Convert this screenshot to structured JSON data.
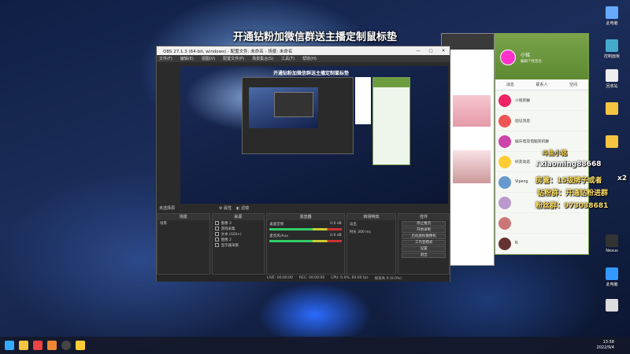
{
  "promo_banner": "开通钻粉加微信群送主播定制鼠标垫",
  "obs": {
    "title": "OBS 27.1.3 (64-bit, windows) - 配置文件: 未命名 - 场景: 未命名",
    "menu": [
      "文件(F)",
      "编辑(E)",
      "视图(V)",
      "配置文件(P)",
      "场景集合(S)",
      "工具(T)",
      "帮助(H)"
    ],
    "preview_title": "开通钻粉加微信群送主播定制鼠标垫",
    "status_left": "未选择源",
    "status_props": "属性",
    "status_filters": "滤镜",
    "docks": {
      "scenes": {
        "header": "场景",
        "item": "场景"
      },
      "sources": {
        "header": "来源",
        "items": [
          "图像 3",
          "游戏采集",
          "文本 (GDI+)",
          "图像 2",
          "显示器采集"
        ]
      },
      "mixer": {
        "header": "混音器",
        "ch1": "桌面音频",
        "ch2": "麦克风/Aux",
        "db": "0.0 dB"
      },
      "transition": {
        "header": "转场特效",
        "label1": "淡出",
        "label2": "时长",
        "duration": "300 ms"
      },
      "controls": {
        "header": "控件",
        "buttons": [
          "停止推流",
          "开始录制",
          "启动虚拟摄像机",
          "工作室模式",
          "设置",
          "退出"
        ]
      }
    },
    "bottom_stats": [
      "LIVE: 00:00:00",
      "REC: 00:00:00",
      "CPU: 0.0%, 60.00 fps",
      "帧丢失 0 (0.0%)"
    ]
  },
  "qq": {
    "name": "小铭",
    "signature": "编辑个性签名",
    "tabs": [
      "消息",
      "联系人",
      "空间"
    ],
    "chats": [
      {
        "name": "小铭的群",
        "sub": "",
        "color": "#e26"
      },
      {
        "name": "验证消息",
        "sub": "",
        "color": "#e55"
      },
      {
        "name": "娱乐电竞电脑装机群",
        "sub": "",
        "color": "#c4a"
      },
      {
        "name": "好友动态",
        "sub": "",
        "color": "#fc3"
      },
      {
        "name": "Vipeng",
        "sub": "",
        "color": "#69c"
      },
      {
        "name": "",
        "sub": "",
        "color": "#b9c"
      },
      {
        "name": "",
        "sub": "",
        "color": "#c77"
      },
      {
        "name": "N",
        "sub": "",
        "color": "#633"
      },
      {
        "name": "",
        "sub": "",
        "color": "#999"
      }
    ]
  },
  "overlays": {
    "douyin": "斗鱼小铭",
    "handle": "xiaoming88668",
    "line1": "房管：15级牌子或者",
    "line2": "钻粉群：开通钻粉进群",
    "line3": "粉丝群：973038681",
    "x2": "x2"
  },
  "desktop_icons": [
    {
      "label": "此电脑",
      "color": "#6af"
    },
    {
      "label": "回收站",
      "color": "#eee"
    },
    {
      "label": "控制面板",
      "color": "#4ac"
    },
    {
      "label": "Nexus",
      "color": "#333"
    },
    {
      "label": "此电脑",
      "color": "#39f"
    }
  ],
  "taskbar": {
    "time": "13:58",
    "date": "2022/9/4"
  }
}
